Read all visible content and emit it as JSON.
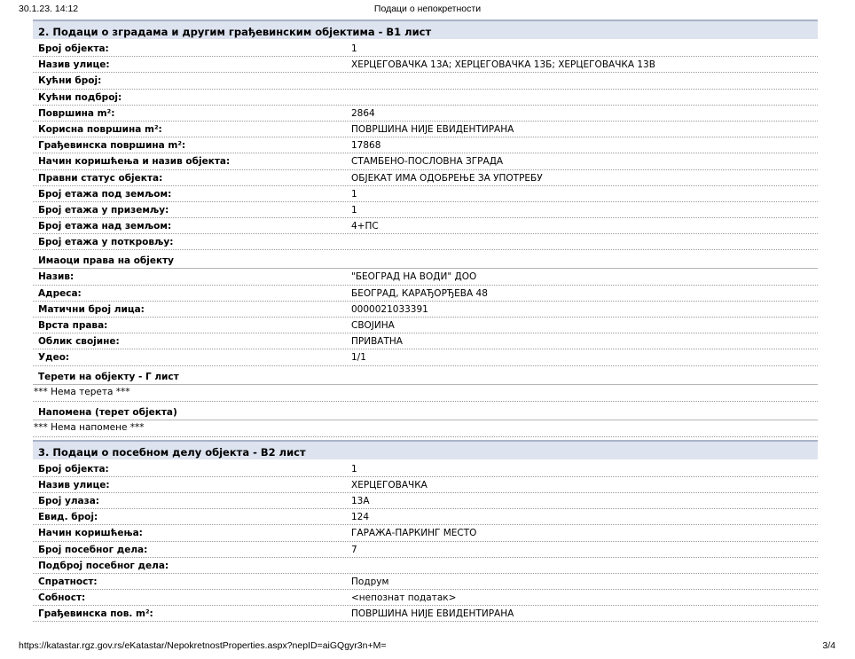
{
  "print": {
    "datetime": "30.1.23. 14:12",
    "title": "Подаци о непокретности",
    "url": "https://katastar.rgz.gov.rs/eKatastar/NepokretnostProperties.aspx?nepID=aiGQgyr3n+M=",
    "page": "3/4"
  },
  "section_b1": {
    "title": "2. Подаци о зградама и другим грађевинским објектима - В1 лист",
    "rows": [
      {
        "label": "Број објекта:",
        "value": "1"
      },
      {
        "label": "Назив улице:",
        "value": "ХЕРЦЕГОВАЧКА 13А; ХЕРЦЕГОВАЧКА 13Б; ХЕРЦЕГОВАЧКА 13В"
      },
      {
        "label": "Кућни број:",
        "value": ""
      },
      {
        "label": "Кућни подброј:",
        "value": ""
      },
      {
        "label": "Површина m²:",
        "value": "2864"
      },
      {
        "label": "Корисна површина m²:",
        "value": "ПОВРШИНА НИЈЕ ЕВИДЕНТИРАНА"
      },
      {
        "label": "Грађевинска површина m²:",
        "value": "17868"
      },
      {
        "label": "Начин коришћења и назив објекта:",
        "value": "СТАМБЕНО-ПОСЛОВНА ЗГРАДА"
      },
      {
        "label": "Правни статус објекта:",
        "value": "ОБЈЕКАТ ИМА ОДОБРЕЊЕ ЗА УПОТРЕБУ"
      },
      {
        "label": "Број етажа под земљом:",
        "value": "1"
      },
      {
        "label": "Број етажа у приземљу:",
        "value": "1"
      },
      {
        "label": "Број етажа над земљом:",
        "value": "4+ПС"
      },
      {
        "label": "Број етажа у поткровљу:",
        "value": ""
      }
    ],
    "owners": {
      "title": "Имаоци права на објекту",
      "rows": [
        {
          "label": "Назив:",
          "value": "\"БЕОГРАД НА ВОДИ\" ДОО"
        },
        {
          "label": "Адреса:",
          "value": "БЕОГРАД, КАРАЂОРЂЕВА 48"
        },
        {
          "label": "Матични број лица:",
          "value": "0000021033391"
        },
        {
          "label": "Врста права:",
          "value": "СВОЈИНА"
        },
        {
          "label": "Облик својине:",
          "value": "ПРИВАТНА"
        },
        {
          "label": "Удео:",
          "value": "1/1"
        }
      ]
    },
    "burdens": {
      "title": "Терети на објекту - Г лист",
      "text": "*** Нема терета ***"
    },
    "notes": {
      "title": "Напомена (терет објекта)",
      "text": "*** Нема напомене ***"
    }
  },
  "section_b2": {
    "title": "3. Подаци о посебном делу објекта - В2 лист",
    "rows": [
      {
        "label": "Број објекта:",
        "value": "1"
      },
      {
        "label": "Назив улице:",
        "value": "ХЕРЦЕГОВАЧКА"
      },
      {
        "label": "Број улаза:",
        "value": "13А"
      },
      {
        "label": "Евид. број:",
        "value": "124"
      },
      {
        "label": "Начин коришћења:",
        "value": "ГАРАЖА-ПАРКИНГ МЕСТО"
      },
      {
        "label": "Број посебног дела:",
        "value": "7"
      },
      {
        "label": "Подброј посебног дела:",
        "value": ""
      },
      {
        "label": "Спратност:",
        "value": "Подрум"
      },
      {
        "label": "Собност:",
        "value": "<непознат податак>"
      },
      {
        "label": "Грађевинска пов. m²:",
        "value": "ПОВРШИНА НИЈЕ ЕВИДЕНТИРАНА"
      }
    ]
  }
}
